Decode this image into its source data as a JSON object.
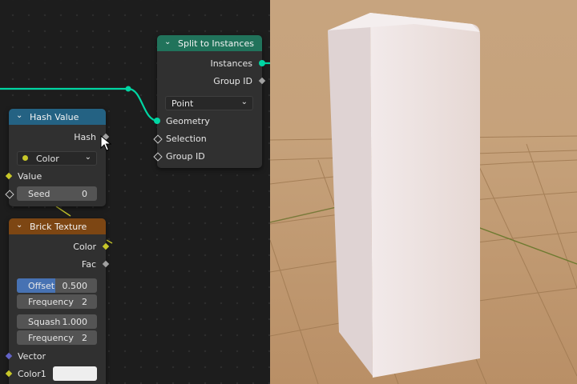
{
  "colors": {
    "geometry_socket": "#00d6a3",
    "color_socket": "#c7c729",
    "vector_socket": "#6363c7",
    "value_socket": "#a1a1a1",
    "split_header": "#21735b",
    "hash_header": "#246283",
    "brick_header": "#7d4613",
    "offset_fill": "#4772b3",
    "color1_swatch": "#eeeeee"
  },
  "split_node": {
    "title": "Split to Instances",
    "instances_label": "Instances",
    "group_id_output": "Group ID",
    "domain": "Point",
    "geometry_label": "Geometry",
    "selection_label": "Selection",
    "group_id_input": "Group ID"
  },
  "hash_node": {
    "title": "Hash Value",
    "hash_label": "Hash",
    "type": "Color",
    "value_label": "Value",
    "seed_label": "Seed",
    "seed_value": "0"
  },
  "brick_node": {
    "title": "Brick Texture",
    "color_label": "Color",
    "fac_label": "Fac",
    "offset_label": "Offset",
    "offset_value": "0.500",
    "offset_frequency_label": "Frequency",
    "offset_frequency_value": "2",
    "squash_label": "Squash",
    "squash_value": "1.000",
    "squash_frequency_label": "Frequency",
    "squash_frequency_value": "2",
    "vector_label": "Vector",
    "color1_label": "Color1"
  }
}
